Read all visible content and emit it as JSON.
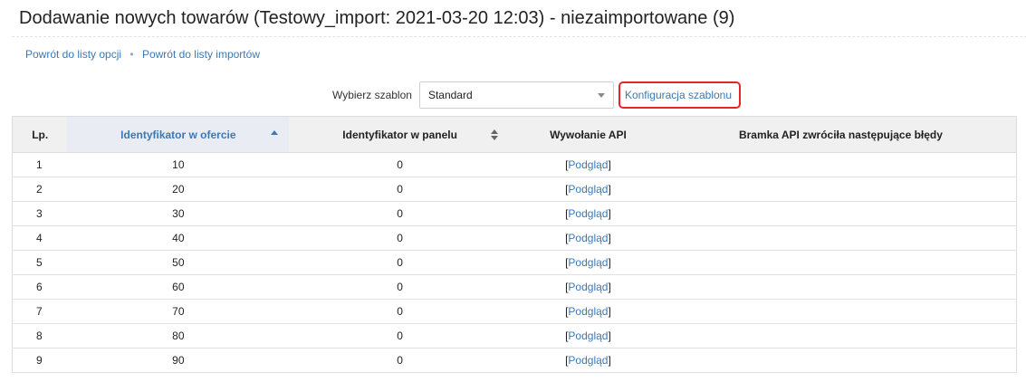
{
  "header": {
    "title": "Dodawanie nowych towarów (Testowy_import: 2021-03-20 12:03) - niezaimportowane (9)"
  },
  "breadcrumb": {
    "items": [
      {
        "label": "Powrót do listy opcji"
      },
      {
        "label": "Powrót do listy importów"
      }
    ],
    "separator": "•"
  },
  "template": {
    "label": "Wybierz szablon",
    "selected": "Standard",
    "config_link": "Konfiguracja szablonu"
  },
  "table": {
    "columns": [
      {
        "label": "Lp."
      },
      {
        "label": "Identyfikator w ofercie",
        "sorted": "asc"
      },
      {
        "label": "Identyfikator w panelu",
        "sortable": true
      },
      {
        "label": "Wywołanie API"
      },
      {
        "label": "Bramka API zwróciła następujące błędy"
      }
    ],
    "preview_open": "[",
    "preview_label": "Podgląd",
    "preview_close": "]",
    "rows": [
      {
        "lp": "1",
        "offer_id": "10",
        "panel_id": "0",
        "errors": ""
      },
      {
        "lp": "2",
        "offer_id": "20",
        "panel_id": "0",
        "errors": ""
      },
      {
        "lp": "3",
        "offer_id": "30",
        "panel_id": "0",
        "errors": ""
      },
      {
        "lp": "4",
        "offer_id": "40",
        "panel_id": "0",
        "errors": ""
      },
      {
        "lp": "5",
        "offer_id": "50",
        "panel_id": "0",
        "errors": ""
      },
      {
        "lp": "6",
        "offer_id": "60",
        "panel_id": "0",
        "errors": ""
      },
      {
        "lp": "7",
        "offer_id": "70",
        "panel_id": "0",
        "errors": ""
      },
      {
        "lp": "8",
        "offer_id": "80",
        "panel_id": "0",
        "errors": ""
      },
      {
        "lp": "9",
        "offer_id": "90",
        "panel_id": "0",
        "errors": ""
      }
    ]
  },
  "colors": {
    "link": "#3a78b6",
    "highlight_border": "#e3252b",
    "header_bg": "#f0f0f0",
    "sorted_header_bg": "#e9edf3"
  }
}
